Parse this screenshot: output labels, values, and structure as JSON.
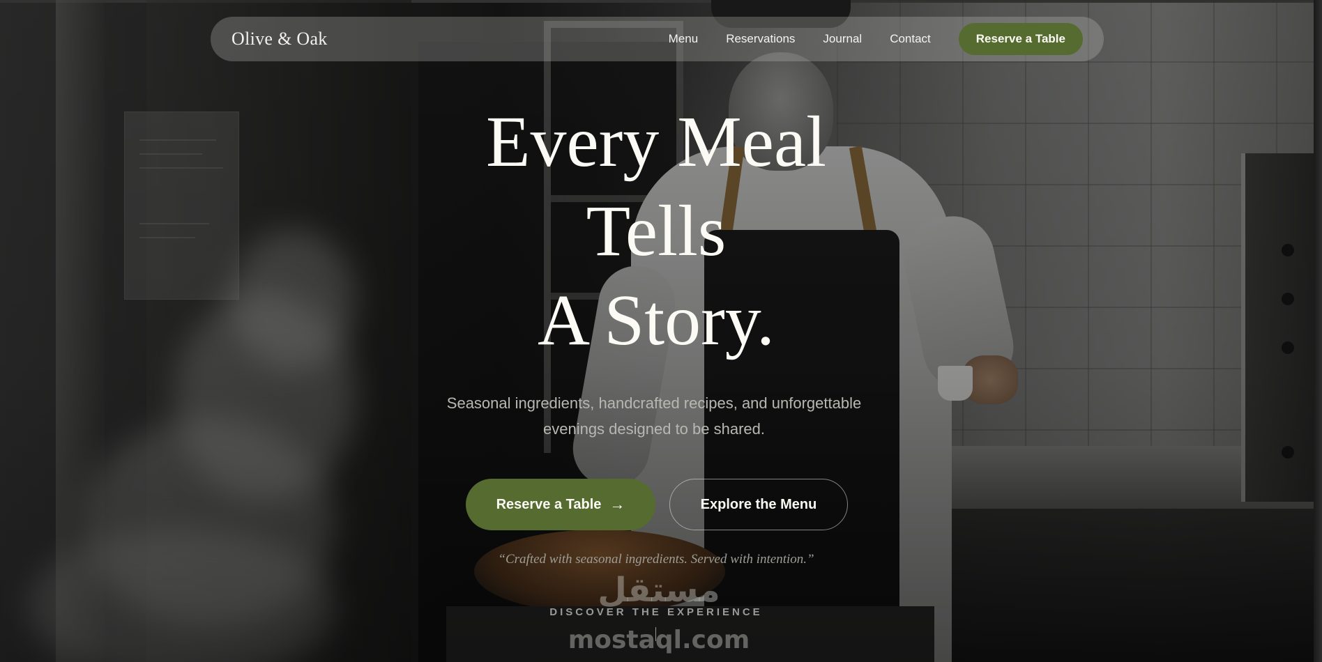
{
  "brand": {
    "name": "Olive & Oak"
  },
  "nav": {
    "links": [
      "Menu",
      "Reservations",
      "Journal",
      "Contact"
    ],
    "cta_label": "Reserve a Table"
  },
  "hero": {
    "headline_line1": "Every Meal",
    "headline_line2": "Tells",
    "headline_line3": "A Story.",
    "subtext": "Seasonal ingredients, handcrafted recipes, and unforgettable evenings designed to be shared.",
    "primary_button": "Reserve a Table",
    "primary_button_icon": "arrow-right-icon",
    "secondary_button": "Explore the Menu",
    "quote": "“Crafted with seasonal ingredients. Served with intention.”",
    "scroll_label": "DISCOVER THE EXPERIENCE"
  },
  "watermark": {
    "arabic": "مستقل",
    "latin": "mostaql.com"
  },
  "colors": {
    "accent_green": "#566b2f",
    "text_light": "#fbfaf4",
    "text_muted": "#b8b8b2"
  }
}
